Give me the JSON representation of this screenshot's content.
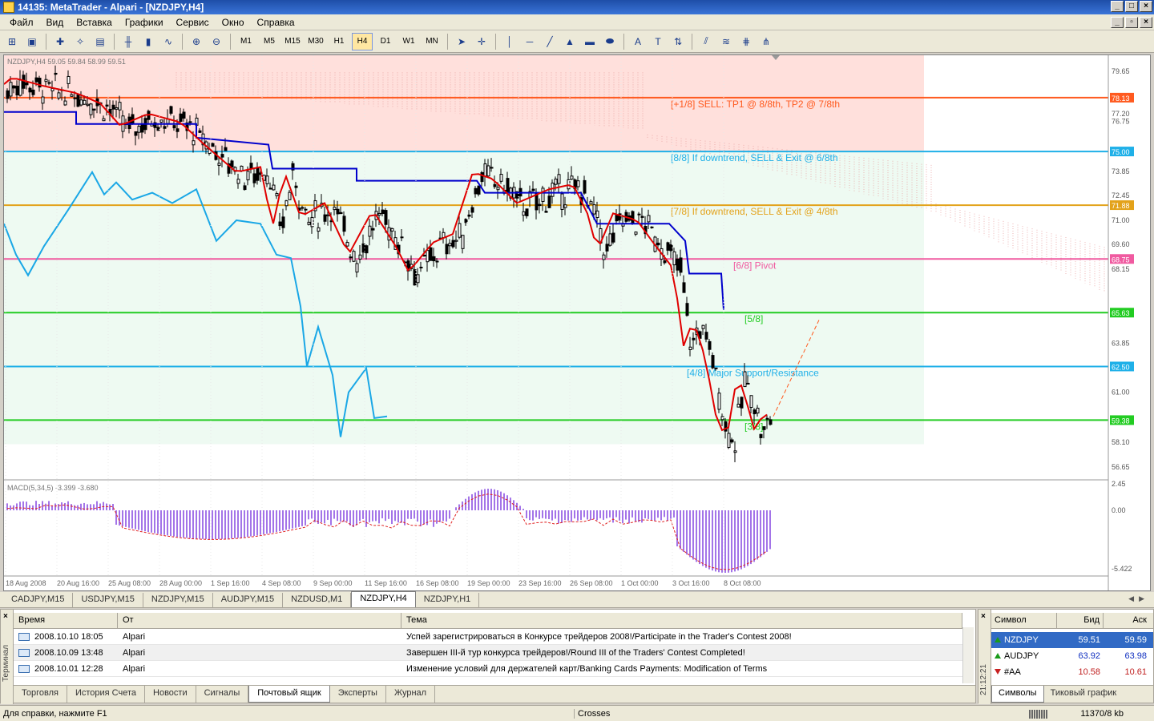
{
  "window": {
    "title": "14135: MetaTrader - Alpari - [NZDJPY,H4]"
  },
  "menu": [
    "Файл",
    "Вид",
    "Вставка",
    "Графики",
    "Сервис",
    "Окно",
    "Справка"
  ],
  "toolbar": {
    "timeframes": [
      "M1",
      "M5",
      "M15",
      "M30",
      "H1",
      "H4",
      "D1",
      "W1",
      "MN"
    ],
    "active_timeframe": "H4"
  },
  "chart": {
    "header": "NZDJPY,H4  59.05 59.84 58.99 59.51",
    "macd_header": "MACD(5,34,5) -3.399 -3.680",
    "colors": {
      "sell_zone": "#ffe0dc",
      "neutral_zone": "#eefaf2",
      "candles": "#000000",
      "tenkan": "#e00000",
      "kijun": "#0000cc",
      "chikou": "#1aa7e6",
      "level_orange": "#ff5a1f",
      "level_sky": "#1fb0e8",
      "level_gold": "#e3a21a",
      "level_pink": "#f05aa0",
      "level_green": "#22cc22",
      "macd_hist": "#a374e8",
      "macd_signal": "#e02020"
    },
    "levels": [
      {
        "id": "p18",
        "label": "[+1/8] SELL: TP1 @ 8/8th, TP2 @ 7/8th",
        "value": 78.13,
        "tag": "78.13",
        "color": "#ff5a1f"
      },
      {
        "id": "8-8",
        "label": "[8/8] If downtrend, SELL & Exit @ 6/8th",
        "value": 75.0,
        "tag": "75.00",
        "color": "#1fb0e8"
      },
      {
        "id": "7-8",
        "label": "[7/8] If downtrend, SELL & Exit @ 4/8th",
        "value": 71.88,
        "tag": "71.88",
        "color": "#e3a21a"
      },
      {
        "id": "6-8",
        "label": "[6/8] Pivot",
        "value": 68.75,
        "tag": "68.75",
        "color": "#f05aa0"
      },
      {
        "id": "5-8",
        "label": "[5/8]",
        "value": 65.63,
        "tag": "65.63",
        "color": "#22cc22"
      },
      {
        "id": "4-8",
        "label": "[4/8] Major Support/Resistance",
        "value": 62.5,
        "tag": "62.50",
        "color": "#1fb0e8"
      },
      {
        "id": "3-8",
        "label": "[3/8]",
        "value": 59.38,
        "tag": "59.38",
        "color": "#22cc22"
      }
    ],
    "price_ticks": [
      "79.65",
      "77.20",
      "76.75",
      "73.85",
      "72.45",
      "71.00",
      "69.60",
      "68.15",
      "63.85",
      "61.00",
      "58.10",
      "56.65"
    ],
    "macd_ticks": [
      "2.45",
      "0.00",
      "-5.422"
    ],
    "time_labels": [
      "18 Aug 2008",
      "20 Aug 16:00",
      "25 Aug 08:00",
      "28 Aug 00:00",
      "1 Sep 16:00",
      "4 Sep 08:00",
      "9 Sep 00:00",
      "11 Sep 16:00",
      "16 Sep 08:00",
      "19 Sep 00:00",
      "23 Sep 16:00",
      "26 Sep 08:00",
      "1 Oct 00:00",
      "3 Oct 16:00",
      "8 Oct 08:00"
    ]
  },
  "chart_tabs": [
    "CADJPY,M15",
    "USDJPY,M15",
    "NZDJPY,M15",
    "AUDJPY,M15",
    "NZDUSD,M1",
    "NZDJPY,H4",
    "NZDJPY,H1"
  ],
  "active_chart_tab": "NZDJPY,H4",
  "terminal": {
    "side_label": "Терминал",
    "columns": [
      "Время",
      "От",
      "Тема"
    ],
    "rows": [
      {
        "time": "2008.10.10 18:05",
        "from": "Alpari",
        "subject": "Успей зарегистрироваться в Конкурсе трейдеров 2008!/Participate in the Trader's Contest 2008!"
      },
      {
        "time": "2008.10.09 13:48",
        "from": "Alpari",
        "subject": "Завершен III-й тур конкурса трейдеров!/Round III of the Traders' Contest Completed!"
      },
      {
        "time": "2008.10.01 12:28",
        "from": "Alpari",
        "subject": "Изменение условий для держателей карт/Banking Cards Payments: Modification of Terms"
      }
    ],
    "tabs": [
      "Торговля",
      "История Счета",
      "Новости",
      "Сигналы",
      "Почтовый ящик",
      "Эксперты",
      "Журнал"
    ],
    "active_tab": "Почтовый ящик"
  },
  "market_watch": {
    "side_label": "21:12:21",
    "columns": [
      "Символ",
      "Бид",
      "Аск"
    ],
    "rows": [
      {
        "symbol": "NZDJPY",
        "bid": "59.51",
        "ask": "59.59",
        "dir": "up",
        "selected": true
      },
      {
        "symbol": "AUDJPY",
        "bid": "63.92",
        "ask": "63.98",
        "dir": "up",
        "selected": false
      },
      {
        "symbol": "#AA",
        "bid": "10.58",
        "ask": "10.61",
        "dir": "down",
        "selected": false
      }
    ],
    "tabs": [
      "Символы",
      "Тиковый график"
    ],
    "active_tab": "Символы"
  },
  "status": {
    "help": "Для справки, нажмите F1",
    "profile": "Crosses",
    "traffic": "11370/8 kb"
  },
  "icons": [
    "app-icon",
    "new-chart-icon",
    "profiles-icon",
    "market-watch-icon",
    "navigator-icon",
    "terminal-icon",
    "bar-chart-icon",
    "candles-icon",
    "line-chart-icon",
    "zoom-in-icon",
    "zoom-out-icon",
    "cursor-icon",
    "crosshair-icon",
    "trendline-icon",
    "text-icon",
    "close-icon"
  ]
}
